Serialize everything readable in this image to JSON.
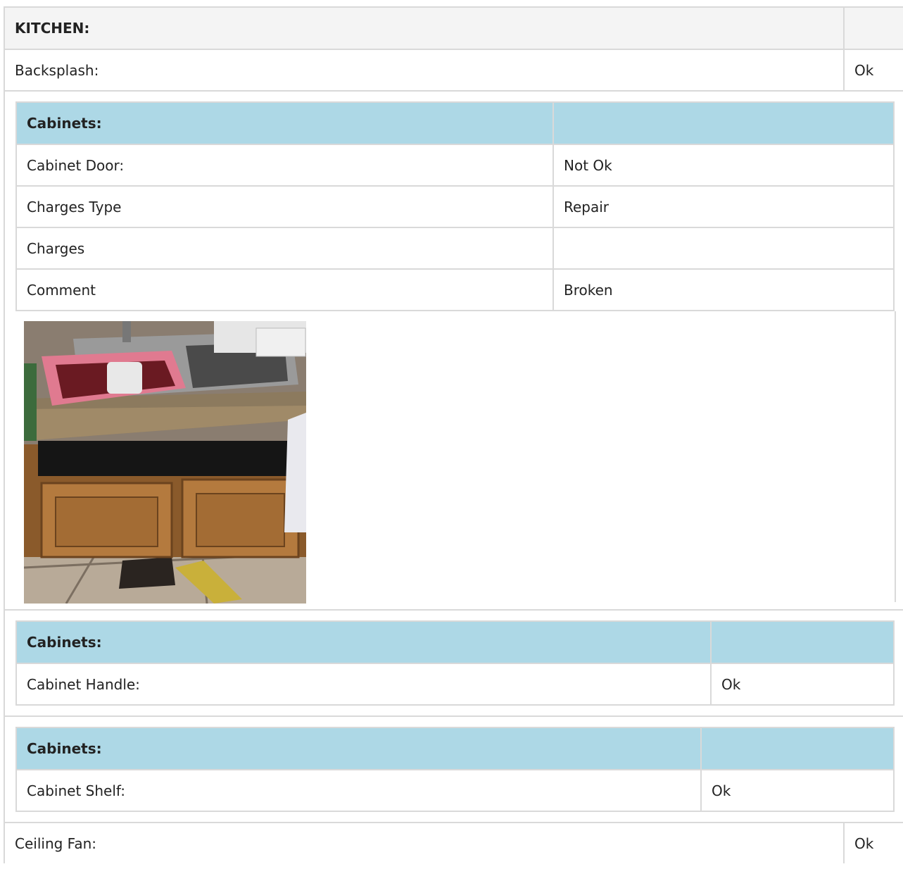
{
  "kitchen": {
    "title": "KITCHEN:",
    "rows": [
      {
        "label": "Backsplash:",
        "value": "Ok"
      }
    ],
    "last_row": {
      "label": "Ceiling Fan:",
      "value": "Ok"
    }
  },
  "cabinets_door": {
    "heading": "Cabinets:",
    "rows": [
      {
        "label": "Cabinet Door:",
        "value": "Not Ok"
      },
      {
        "label": "Charges Type",
        "value": "Repair"
      },
      {
        "label": "Charges",
        "value": ""
      },
      {
        "label": "Comment",
        "value": "Broken"
      }
    ]
  },
  "cabinets_handle": {
    "heading": "Cabinets:",
    "rows": [
      {
        "label": "Cabinet Handle:",
        "value": "Ok"
      }
    ]
  },
  "cabinets_shelf": {
    "heading": "Cabinets:",
    "rows": [
      {
        "label": "Cabinet Shelf:",
        "value": "Ok"
      }
    ]
  },
  "colors": {
    "section_header_bg": "#add8e6",
    "kitchen_header_bg": "#f4f4f4",
    "border": "#d9d9d9"
  }
}
